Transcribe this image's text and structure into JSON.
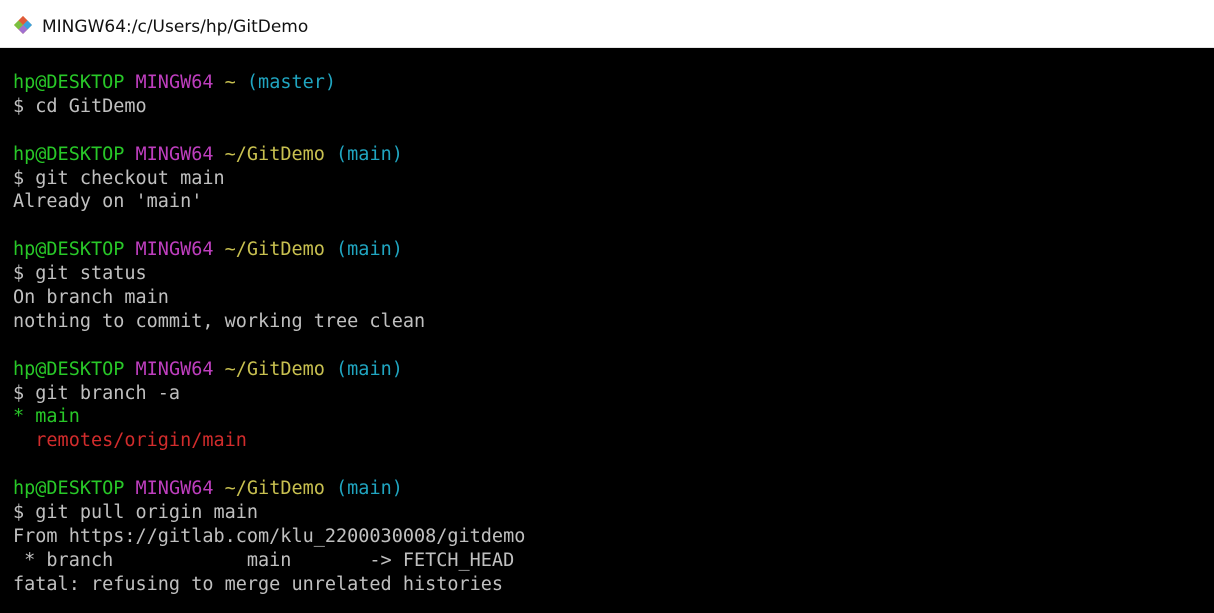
{
  "window": {
    "title": "MINGW64:/c/Users/hp/GitDemo",
    "icon": "git-bash-icon"
  },
  "colors": {
    "user_host": "#28c828",
    "shell": "#be3ebe",
    "path": "#c8c050",
    "branch": "#20a5c0",
    "remote_branch": "#d22c2c",
    "text": "#c0c0c0",
    "background": "#000000"
  },
  "terminal": {
    "p1": {
      "user": "hp@DESKTOP",
      "shell": "MINGW64",
      "path": "~",
      "branch": "(master)"
    },
    "c1": "$ cd GitDemo",
    "p2": {
      "user": "hp@DESKTOP",
      "shell": "MINGW64",
      "path": "~/GitDemo",
      "branch": "(main)"
    },
    "c2": "$ git checkout main",
    "o2_1": "Already on 'main'",
    "p3": {
      "user": "hp@DESKTOP",
      "shell": "MINGW64",
      "path": "~/GitDemo",
      "branch": "(main)"
    },
    "c3": "$ git status",
    "o3_1": "On branch main",
    "o3_2": "nothing to commit, working tree clean",
    "p4": {
      "user": "hp@DESKTOP",
      "shell": "MINGW64",
      "path": "~/GitDemo",
      "branch": "(main)"
    },
    "c4": "$ git branch -a",
    "o4_1": "* main",
    "o4_2": "  remotes/origin/main",
    "p5": {
      "user": "hp@DESKTOP",
      "shell": "MINGW64",
      "path": "~/GitDemo",
      "branch": "(main)"
    },
    "c5": "$ git pull origin main",
    "o5_1": "From https://gitlab.com/klu_2200030008/gitdemo",
    "o5_2": " * branch            main       -> FETCH_HEAD",
    "o5_3": "fatal: refusing to merge unrelated histories"
  }
}
